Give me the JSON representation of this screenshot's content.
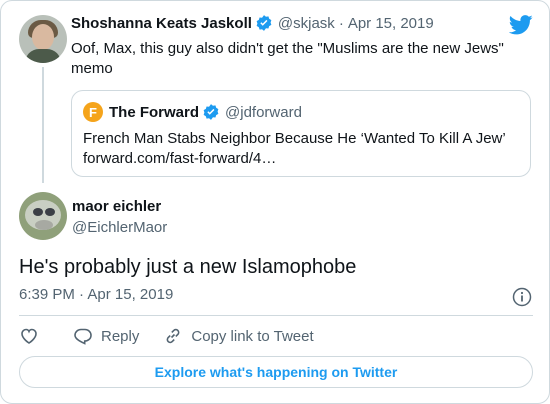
{
  "colors": {
    "accent": "#1d9bf0",
    "text": "#0f1419",
    "muted": "#536471",
    "border": "#cfd9de",
    "forward_logo": "#f5a41b"
  },
  "parent_tweet": {
    "author_name": "Shoshanna Keats Jaskoll",
    "handle": "@skjask",
    "separator": "·",
    "date": "Apr 15, 2019",
    "verified_icon": "verified-badge-icon",
    "text": "Oof, Max, this guy also didn't get the \"Muslims are the new Jews\" memo"
  },
  "quoted_tweet": {
    "logo_letter": "F",
    "author_name": "The Forward",
    "handle": "@jdforward",
    "text_line1": "French Man Stabs Neighbor Because He ‘Wanted To Kill A Jew’",
    "text_line2": "forward.com/fast-forward/4…"
  },
  "reply_tweet": {
    "author_name": "maor eichler",
    "handle": "@EichlerMaor",
    "text": "He's probably just a new Islamophobe",
    "time": "6:39 PM",
    "separator": "·",
    "date": "Apr 15, 2019"
  },
  "actions": {
    "like_icon": "heart-icon",
    "reply_label": "Reply",
    "copy_link_label": "Copy link to Tweet"
  },
  "footer": {
    "explore_label": "Explore what's happening on Twitter"
  }
}
